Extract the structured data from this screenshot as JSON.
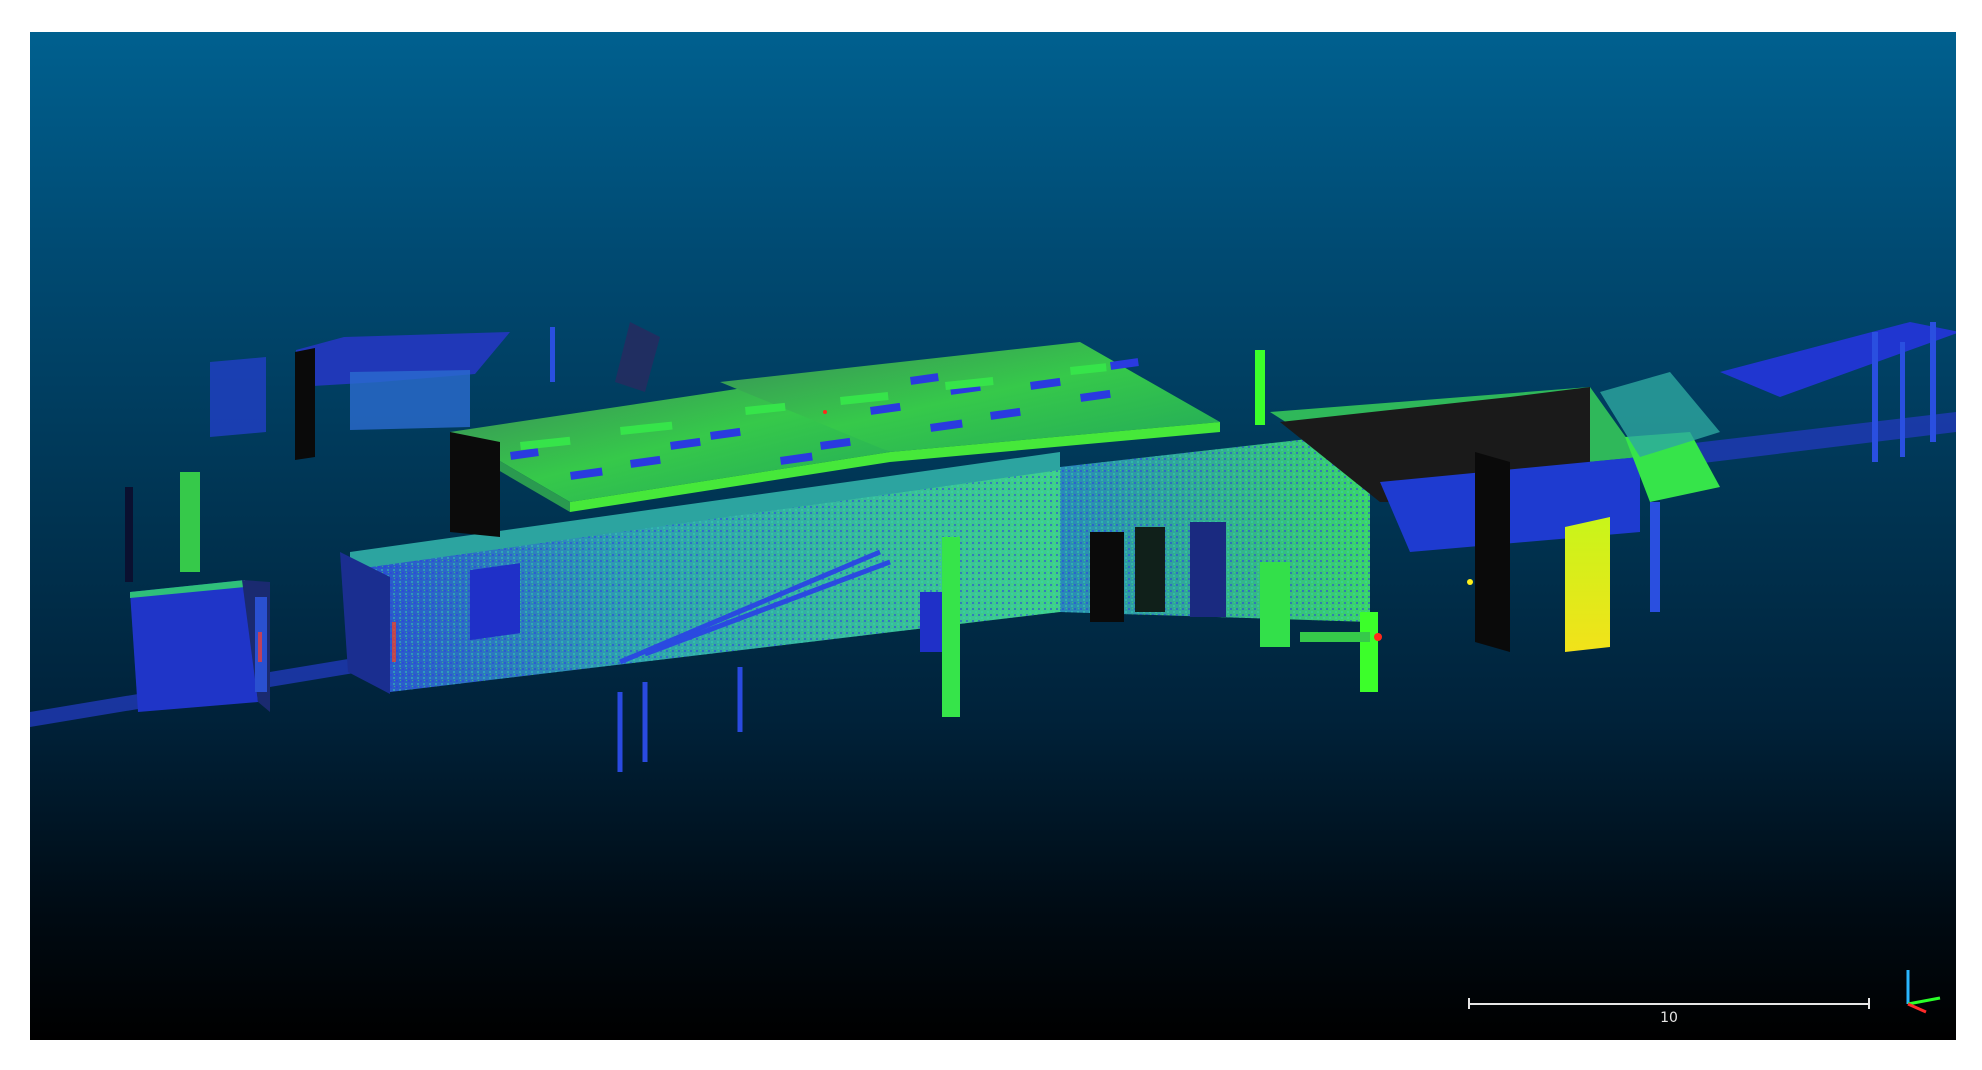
{
  "viewer": {
    "background_top": "#00608f",
    "background_bottom": "#000000"
  },
  "scale_bar": {
    "label": "10"
  },
  "axis_colors": {
    "x": "#ff2a2a",
    "y": "#2aff2a",
    "z": "#29b6ff"
  },
  "point_cloud_palette": {
    "low": "#1a2bd6",
    "mid": "#27c6a8",
    "high": "#3cff2a",
    "peak": "#ffef1a",
    "max": "#ff2a1a"
  }
}
